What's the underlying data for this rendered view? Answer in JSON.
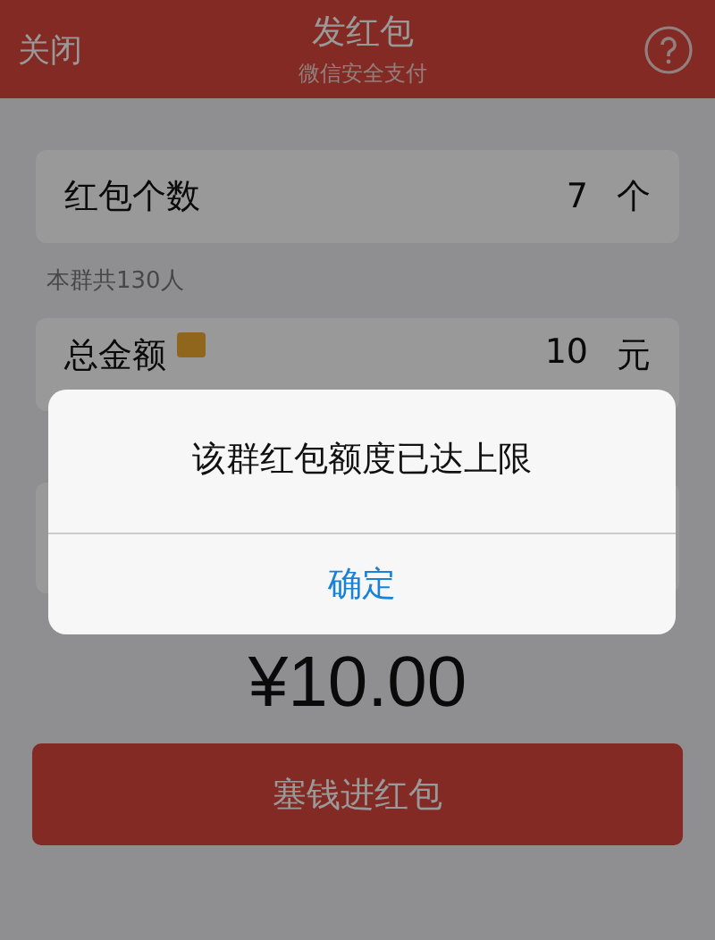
{
  "header": {
    "close": "关闭",
    "title": "发红包",
    "subtitle": "微信安全支付"
  },
  "count_row": {
    "label": "红包个数",
    "value": "7",
    "unit": "个"
  },
  "group_note": "本群共130人",
  "amount_row": {
    "label": "总金额",
    "value": "10",
    "unit": "元"
  },
  "total": "¥10.00",
  "submit_button": "塞钱进红包",
  "dialog": {
    "message": "该群红包额度已达上限",
    "button": "确定"
  }
}
